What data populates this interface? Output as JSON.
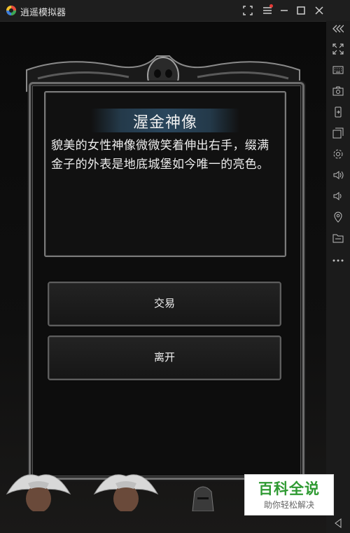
{
  "window": {
    "title": "逍遥模拟器",
    "controls": [
      "fullscreen-icon",
      "menu-icon",
      "minimize-icon",
      "maximize-icon",
      "close-icon"
    ]
  },
  "sidebar": {
    "icons": [
      "collapse-icon",
      "resize-icon",
      "keyboard-icon",
      "screenshot-icon",
      "rotate-icon",
      "multi-window-icon",
      "settings-icon",
      "volume-up-icon",
      "volume-down-icon",
      "location-icon",
      "folder-icon",
      "more-icon",
      "back-icon"
    ]
  },
  "event": {
    "title": "渥金神像",
    "description": "貌美的女性神像微微笑着伸出右手，缀满金子的外表是地底城堡如今唯一的亮色。"
  },
  "choices": {
    "trade": "交易",
    "leave": "离开"
  },
  "watermark": {
    "title": "百科全说",
    "subtitle": "助你轻松解决"
  },
  "colors": {
    "background": "#0b0b0b",
    "frame": "#6d6d6d",
    "title_banner": "#2a465c",
    "watermark_green": "#2f9a32"
  }
}
